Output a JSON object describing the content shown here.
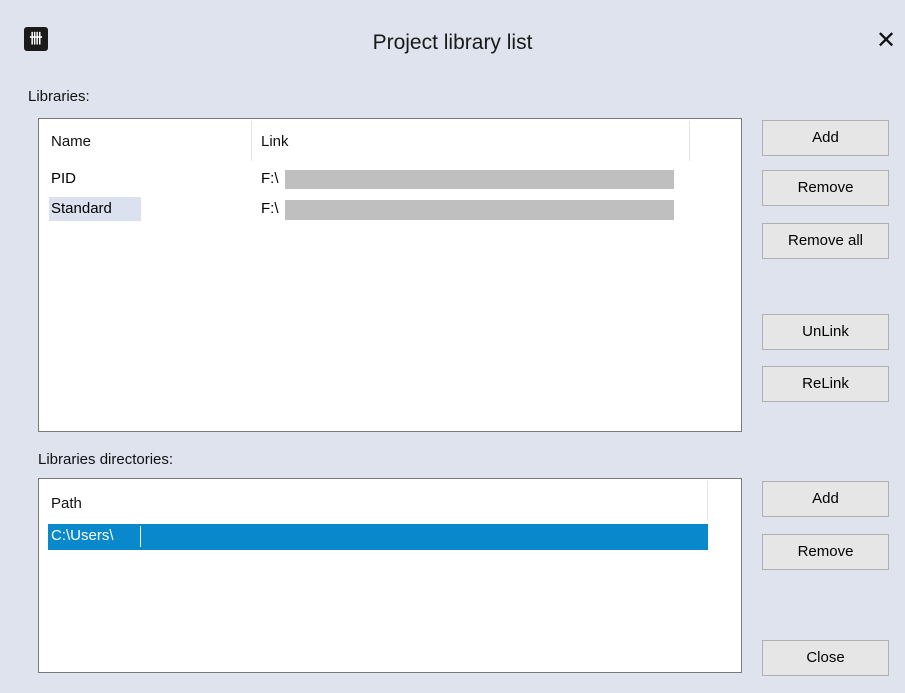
{
  "window": {
    "title": "Project library list",
    "icon": "app-logo-icon",
    "close_glyph": "✕"
  },
  "libraries": {
    "label": "Libraries:",
    "columns": [
      "Name",
      "Link"
    ],
    "rows": [
      {
        "name": "PID",
        "link": "F:\\"
      },
      {
        "name": "Standard",
        "link": "F:\\"
      }
    ],
    "buttons": {
      "add": "Add",
      "remove": "Remove",
      "remove_all": "Remove all",
      "unlink": "UnLink",
      "relink": "ReLink"
    }
  },
  "directories": {
    "label": "Libraries directories:",
    "columns": [
      "Path"
    ],
    "rows": [
      {
        "path": "C:\\Users\\"
      }
    ],
    "buttons": {
      "add": "Add",
      "remove": "Remove",
      "close": "Close"
    }
  },
  "colors": {
    "background": "#dfe3ee",
    "selection": "#0a88cc",
    "inactive_selection": "#dbe1ee"
  }
}
